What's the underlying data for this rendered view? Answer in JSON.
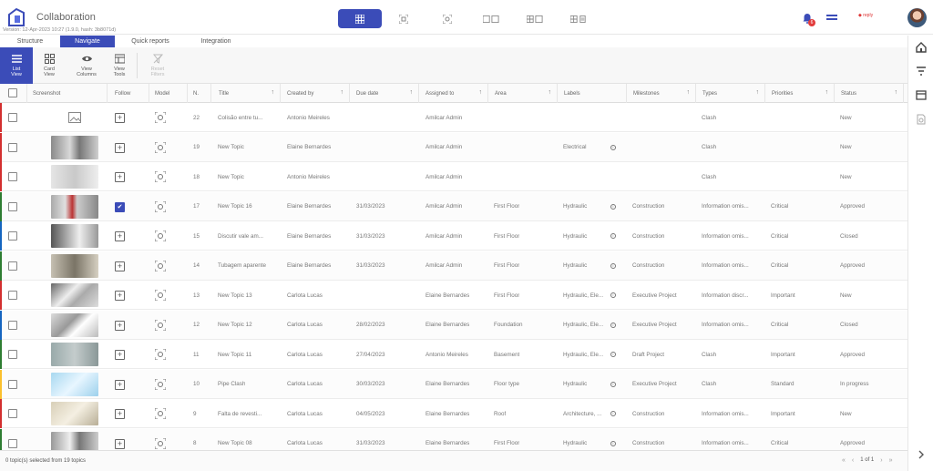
{
  "header": {
    "title": "Collaboration",
    "version": "Version: 12-Apr-2023 10:27 (1.9.0, hash: 3b8071d)",
    "notification_count": "6",
    "org_logo": "◆ reply"
  },
  "tabs": [
    {
      "label": "Structure",
      "active": false
    },
    {
      "label": "Navigate",
      "active": true
    },
    {
      "label": "Quick reports",
      "active": false
    },
    {
      "label": "Integration",
      "active": false
    }
  ],
  "toolbar": {
    "list_view": "List\nView",
    "card_view": "Card\nView",
    "view_columns": "View\nColumns",
    "view_tools": "View\nTools",
    "reset_filter": "Reset\nFilters"
  },
  "columns": {
    "screenshot": "Screenshot",
    "follow": "Follow",
    "model": "Model",
    "n": "N.",
    "title": "Title",
    "created_by": "Created by",
    "due_date": "Due date",
    "assigned_to": "Assigned to",
    "area": "Area",
    "labels": "Labels",
    "milestones": "Milestones",
    "types": "Types",
    "priorities": "Priorities",
    "status": "Status"
  },
  "rows": [
    {
      "n": "22",
      "title": "Colisão entre tu...",
      "created_by": "Antonio Meireles",
      "due": "",
      "assigned": "Amilcar Admin",
      "area": "",
      "labels": "",
      "milestone": "",
      "type": "Clash",
      "priority": "",
      "status": "New",
      "followed": false,
      "bar": "#d32f2f"
    },
    {
      "n": "19",
      "title": "New Topic",
      "created_by": "Elaine Bernardes",
      "due": "",
      "assigned": "Amilcar Admin",
      "area": "",
      "labels": "Electrical",
      "milestone": "",
      "type": "Clash",
      "priority": "",
      "status": "New",
      "followed": false,
      "bar": "#d32f2f"
    },
    {
      "n": "18",
      "title": "New Topic",
      "created_by": "Antonio Meireles",
      "due": "",
      "assigned": "Amilcar Admin",
      "area": "",
      "labels": "",
      "milestone": "",
      "type": "Clash",
      "priority": "",
      "status": "New",
      "followed": false,
      "bar": "#d32f2f"
    },
    {
      "n": "17",
      "title": "New Topic 16",
      "created_by": "Elaine Bernardes",
      "due": "31/03/2023",
      "assigned": "Amilcar Admin",
      "area": "First Floor",
      "labels": "Hydraulic",
      "milestone": "Construction",
      "type": "Information omis...",
      "priority": "Critical",
      "status": "Approved",
      "followed": true,
      "bar": "#2e7d32"
    },
    {
      "n": "15",
      "title": "Discutir vale am...",
      "created_by": "Elaine Bernardes",
      "due": "31/03/2023",
      "assigned": "Amilcar Admin",
      "area": "First Floor",
      "labels": "Hydraulic",
      "milestone": "Construction",
      "type": "Information omis...",
      "priority": "Critical",
      "status": "Closed",
      "followed": false,
      "bar": "#1565c0"
    },
    {
      "n": "14",
      "title": "Tubagem aparente",
      "created_by": "Elaine Bernardes",
      "due": "31/03/2023",
      "assigned": "Amilcar Admin",
      "area": "First Floor",
      "labels": "Hydraulic",
      "milestone": "Construction",
      "type": "Information omis...",
      "priority": "Critical",
      "status": "Approved",
      "followed": false,
      "bar": "#2e7d32"
    },
    {
      "n": "13",
      "title": "New Topic 13",
      "created_by": "Carlota Lucas",
      "due": "",
      "assigned": "Elaine Bernardes",
      "area": "First Floor",
      "labels": "Hydraulic, Ele...",
      "milestone": "Executive Project",
      "type": "Information discr...",
      "priority": "Important",
      "status": "New",
      "followed": false,
      "bar": "#d32f2f"
    },
    {
      "n": "12",
      "title": "New Topic 12",
      "created_by": "Carlota Lucas",
      "due": "28/02/2023",
      "assigned": "Elaine Bernardes",
      "area": "Foundation",
      "labels": "Hydraulic, Ele...",
      "milestone": "Executive Project",
      "type": "Information omis...",
      "priority": "Critical",
      "status": "Closed",
      "followed": false,
      "bar": "#1565c0"
    },
    {
      "n": "11",
      "title": "New Topic 11",
      "created_by": "Carlota Lucas",
      "due": "27/04/2023",
      "assigned": "Antonio Meireles",
      "area": "Basement",
      "labels": "Hydraulic, Ele...",
      "milestone": "Draft Project",
      "type": "Clash",
      "priority": "Important",
      "status": "Approved",
      "followed": false,
      "bar": "#2e7d32"
    },
    {
      "n": "10",
      "title": "Pipe Clash",
      "created_by": "Carlota Lucas",
      "due": "30/03/2023",
      "assigned": "Elaine Bernardes",
      "area": "Floor type",
      "labels": "Hydraulic",
      "milestone": "Executive Project",
      "type": "Clash",
      "priority": "Standard",
      "status": "In progress",
      "followed": false,
      "bar": "#fbc02d"
    },
    {
      "n": "9",
      "title": "Falta de revesti...",
      "created_by": "Carlota Lucas",
      "due": "04/05/2023",
      "assigned": "Elaine Bernardes",
      "area": "Roof",
      "labels": "Architecture, ...",
      "milestone": "Construction",
      "type": "Information omis...",
      "priority": "Important",
      "status": "New",
      "followed": false,
      "bar": "#d32f2f"
    },
    {
      "n": "8",
      "title": "New Topic 08",
      "created_by": "Carlota Lucas",
      "due": "31/03/2023",
      "assigned": "Elaine Bernardes",
      "area": "First Floor",
      "labels": "Hydraulic",
      "milestone": "Construction",
      "type": "Information omis...",
      "priority": "Critical",
      "status": "Approved",
      "followed": false,
      "bar": "#2e7d32"
    }
  ],
  "footer": {
    "selection": "0 topic(s) selected from 19 topics",
    "page": "1 of 1"
  },
  "colors": {
    "accent": "#3b4cb8"
  }
}
